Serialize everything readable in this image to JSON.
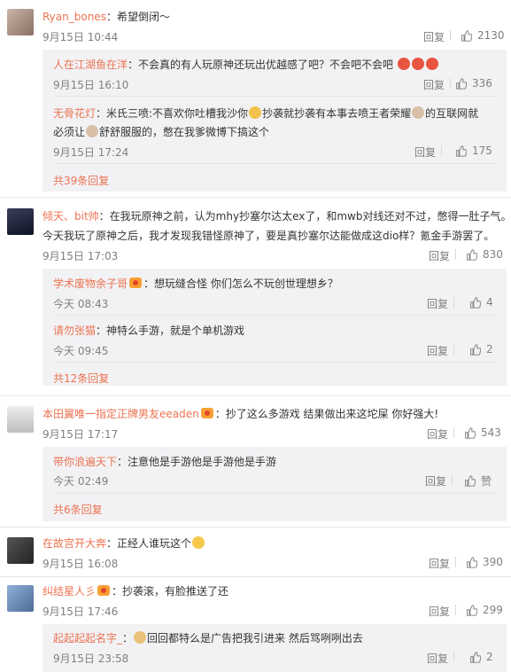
{
  "colors": {
    "name": "#eb7350",
    "reply_bg": "#f2f2f5",
    "muted": "#808080"
  },
  "reply_label": "回复",
  "comments": [
    {
      "user": "Ryan_bones",
      "text": "：希望倒闭～",
      "time": "9月15日 10:44",
      "likes": "2130",
      "replies": [
        {
          "user": "人在江湖鱼在洋",
          "text": "：不会真的有人玩原神还玩出优越感了吧？不会吧不会吧",
          "time": "9月15日 16:10",
          "likes": "336"
        },
        {
          "user": "无骨花灯",
          "text_a": "：米氏三喷:不喜欢你吐槽我沙你",
          "text_b": "抄袭就抄袭有本事去喷王者荣耀",
          "text_c": "的互联网就",
          "text_d": "必须让",
          "text_e": "舒舒服服的，憋在我爹微博下搞这个",
          "time": "9月15日 17:24",
          "likes": "175"
        }
      ],
      "more": "共39条回复"
    },
    {
      "user": "倾天、bit帅",
      "text_line1": "：在我玩原神之前，认为mhy抄塞尔达太ex了，和mwb对线还对不过，憋得一肚子气。",
      "text_line2": "今天我玩了原神之后，我才发现我错怪原神了，要是真抄塞尔达能做成这dio样？氪金手游罢了。",
      "time": "9月15日 17:03",
      "likes": "830",
      "replies": [
        {
          "user": "学术废物余子哥",
          "text": "：想玩缝合怪  你们怎么不玩创世理想乡？",
          "time": "今天 08:43",
          "likes": "4"
        },
        {
          "user": "请勿张猫",
          "text": "：神特么手游，就是个单机游戏",
          "time": "今天 09:45",
          "likes": "2"
        }
      ],
      "more": "共12条回复"
    },
    {
      "user": "本田翼唯一指定正牌男友eeaden",
      "text": "：抄了这么多游戏 结果做出来这坨屎 你好强大!",
      "time": "9月15日 17:17",
      "likes": "543",
      "replies": [
        {
          "user": "带你浪遍天下",
          "text": "：注意他是手游他是手游他是手游",
          "time": "今天 02:49",
          "likes": "赞"
        }
      ],
      "more": "共6条回复"
    },
    {
      "user": "在故宫开大奔",
      "text": "：正经人谁玩这个",
      "time": "9月15日 16:08",
      "likes": "390",
      "replies": [],
      "more": ""
    },
    {
      "user": "纠结星人彡",
      "text": "：抄袭滚，有脸推送了还",
      "time": "9月15日 17:46",
      "likes": "299",
      "replies": [
        {
          "user": "起起起起名字_",
          "text": "回回都特么是广告把我引进来 然后骂咧咧出去",
          "text_prefix": "：",
          "time": "9月15日 23:58",
          "likes": "2"
        }
      ],
      "more": ""
    }
  ]
}
